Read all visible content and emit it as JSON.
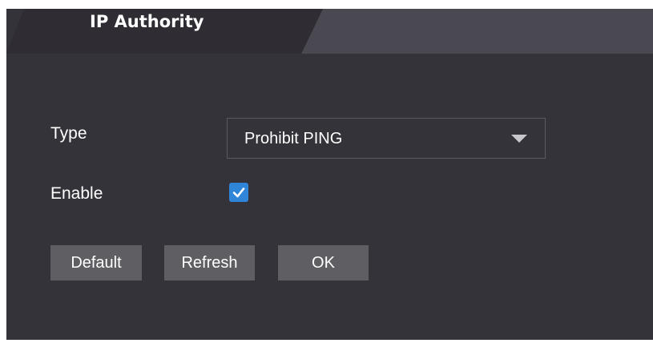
{
  "tab": {
    "title": "IP Authority"
  },
  "form": {
    "type_label": "Type",
    "type_value": "Prohibit PING",
    "enable_label": "Enable",
    "enable_checked": true
  },
  "buttons": {
    "default_label": "Default",
    "refresh_label": "Refresh",
    "ok_label": "OK"
  },
  "colors": {
    "panel_bg": "#35333a",
    "tab_active": "#2f2d33",
    "tab_inactive": "#4a4850",
    "checkbox_accent": "#2f86d8",
    "button_bg": "#5f5e63"
  },
  "icons": {
    "dropdown": "chevron-down-icon",
    "checkbox": "checkmark-icon"
  }
}
